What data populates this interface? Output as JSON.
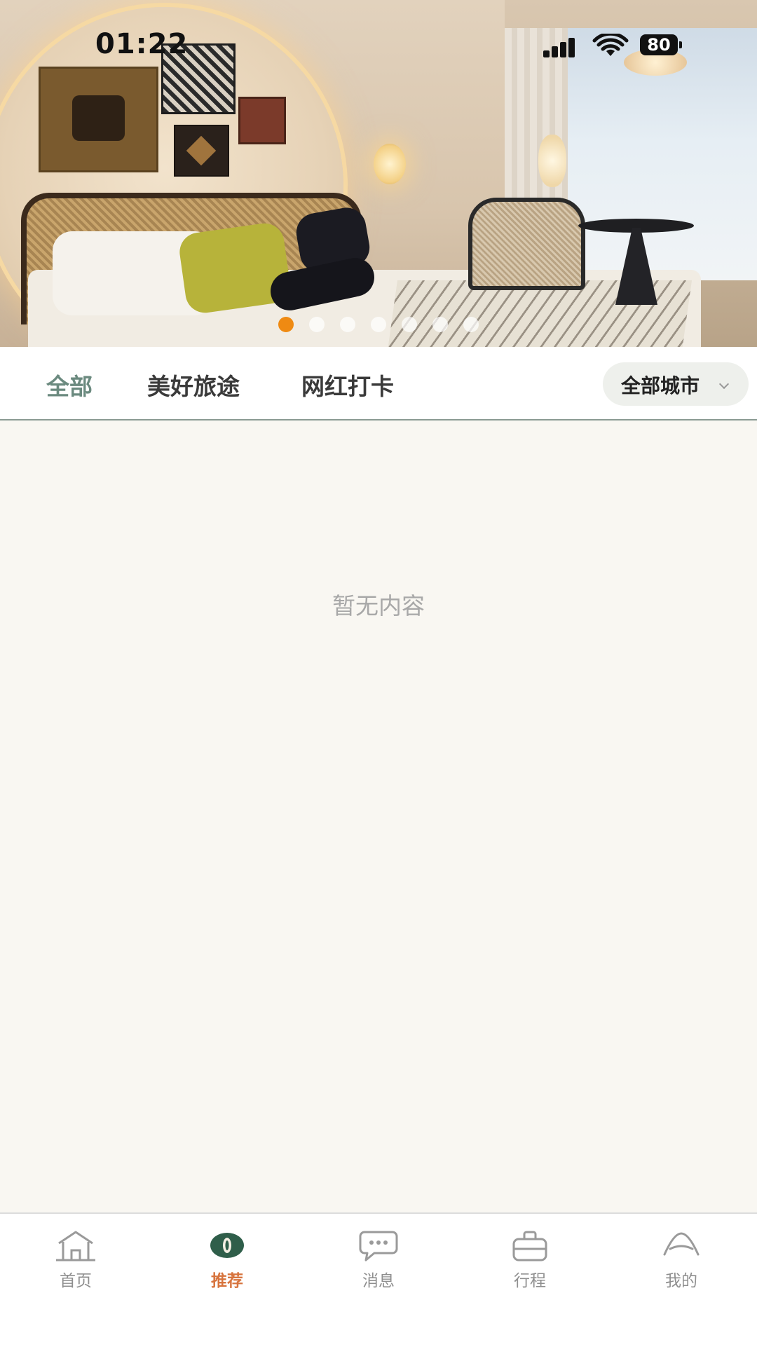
{
  "status_bar": {
    "time": "01:22",
    "battery": "80",
    "signal_icon": "cellular-signal-icon",
    "wifi_icon": "wifi-icon"
  },
  "banner": {
    "page_count": 7,
    "active_index": 0,
    "active_color": "#ef8a12"
  },
  "category_tabs": {
    "items": [
      {
        "label": "全部",
        "active": true
      },
      {
        "label": "美好旅途",
        "active": false
      },
      {
        "label": "网红打卡",
        "active": false
      }
    ],
    "active_color": "#6b8a7f",
    "city_filter": {
      "label": "全部城市",
      "icon": "chevron-down-icon"
    }
  },
  "content": {
    "empty_text": "暂无内容"
  },
  "tab_bar": {
    "items": [
      {
        "label": "首页",
        "icon": "home-icon",
        "active": false
      },
      {
        "label": "推荐",
        "icon": "eye-icon",
        "active": true
      },
      {
        "label": "消息",
        "icon": "chat-bubble-icon",
        "active": false
      },
      {
        "label": "行程",
        "icon": "suitcase-icon",
        "active": false
      },
      {
        "label": "我的",
        "icon": "profile-icon",
        "active": false
      }
    ],
    "active_color": "#d7743e",
    "inactive_color": "#8f8f8f"
  }
}
